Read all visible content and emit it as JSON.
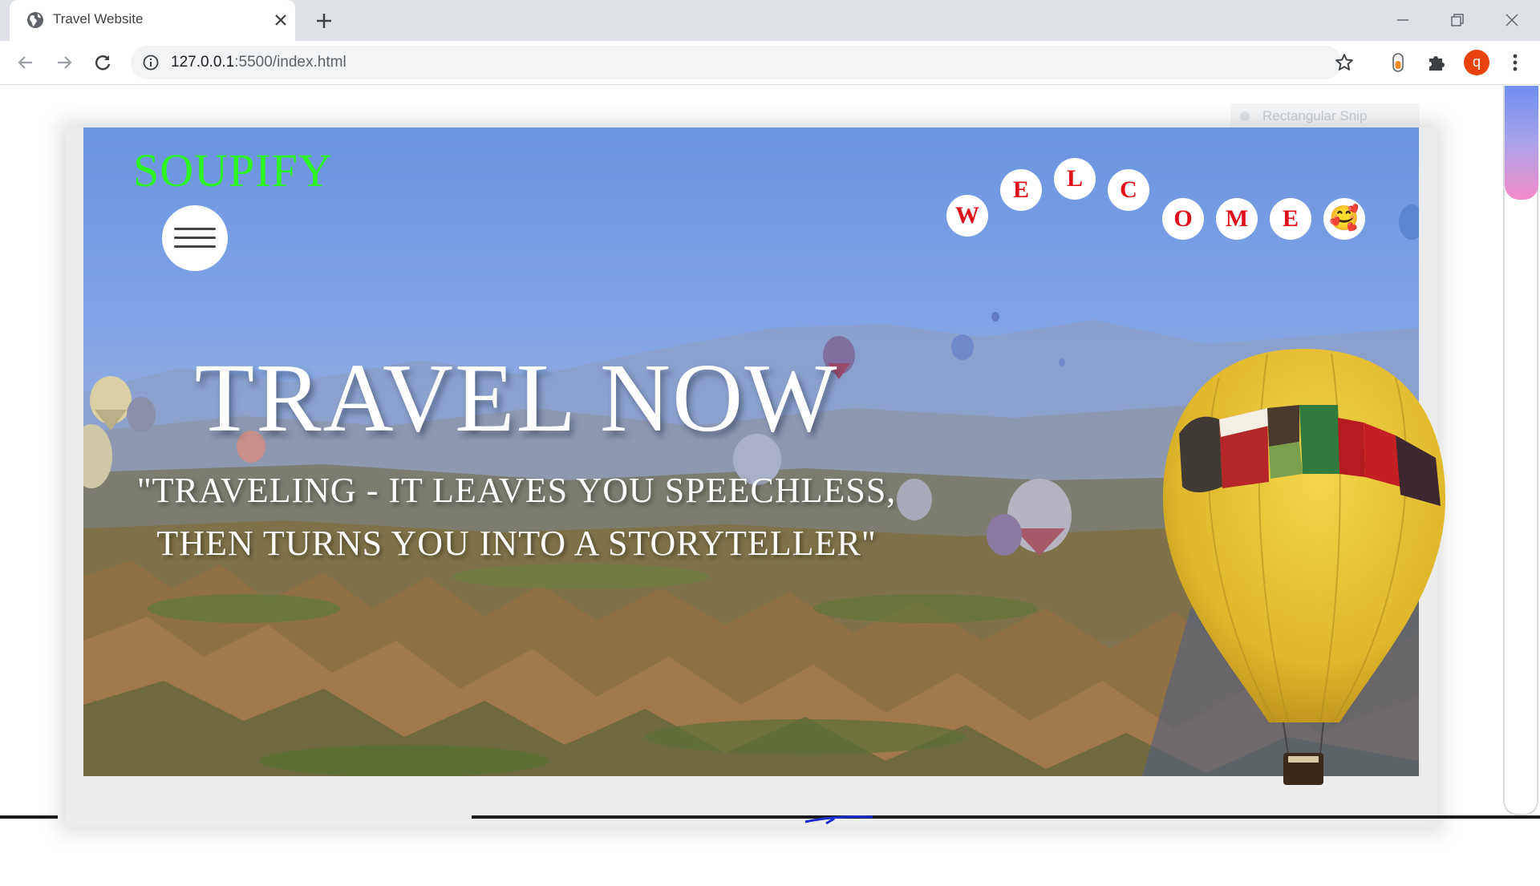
{
  "browser": {
    "tab_title": "Travel Website",
    "url_host": "127.0.0.1",
    "url_rest": ":5500/index.html",
    "profile_initial": "q"
  },
  "page": {
    "brand": "SOUPIFY",
    "headline": "TRAVEL NOW",
    "quote_line1": "\"TRAVELING - IT LEAVES YOU SPEECHLESS,",
    "quote_line2": "THEN TURNS YOU INTO A STORYTELLER\"",
    "welcome_letters": [
      "W",
      "E",
      "L",
      "C",
      "O",
      "M",
      "E"
    ],
    "welcome_emoji": "🥰",
    "snip_ghost": "Rectangular Snip"
  },
  "colors": {
    "brand": "#2cf51f",
    "letter": "#e0101a",
    "profile": "#e8430b"
  },
  "icons": [
    "globe-icon",
    "close-icon",
    "plus-icon",
    "minimize-icon",
    "restore-icon",
    "window-close-icon",
    "back-arrow-icon",
    "forward-arrow-icon",
    "reload-icon",
    "info-icon",
    "star-icon",
    "extension-icon",
    "puzzle-icon",
    "more-vert-icon",
    "hamburger-icon"
  ]
}
